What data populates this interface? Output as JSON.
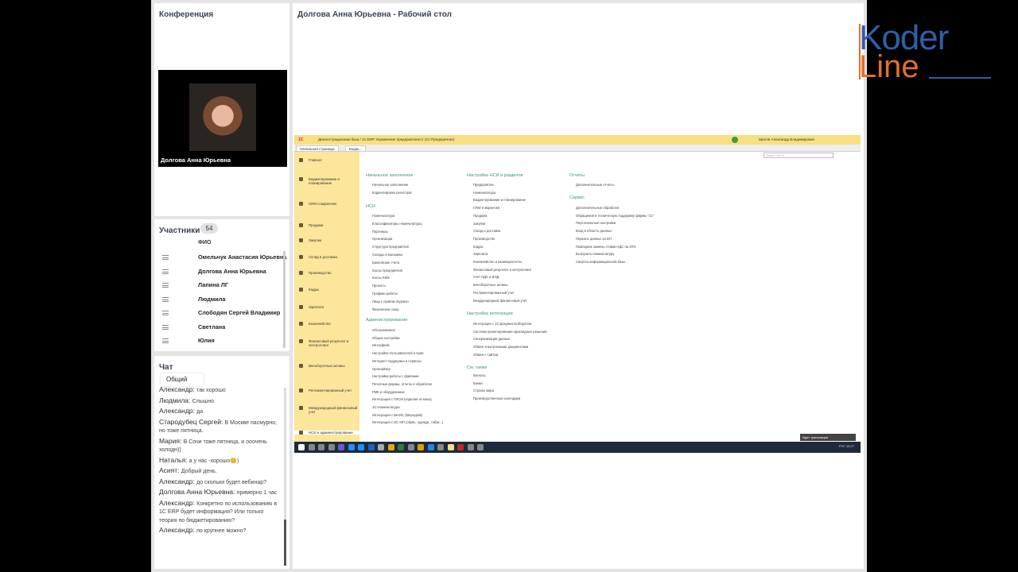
{
  "conference": {
    "title": "Конференция",
    "speaker_name": "Долгова Анна Юрьевна"
  },
  "participants": {
    "title": "Участники",
    "count": "54",
    "column_header": "ФИО",
    "list": [
      "Омельчук Анастасия Юрьевна",
      "Долгова Анна Юрьевна",
      "Лапина ЛГ",
      "Людмила",
      "Слободян Сергей Владимир",
      "Светлана",
      "Юлия"
    ]
  },
  "chat": {
    "title": "Чат",
    "tab": "Общий",
    "messages": [
      {
        "author": "Александр:",
        "text": "так хорошо"
      },
      {
        "author": "Людмила:",
        "text": "Слышно"
      },
      {
        "author": "Александр:",
        "text": "да"
      },
      {
        "author": "Стародубец Сергей:",
        "text": "В Москве пасмурно, но тоже пятница."
      },
      {
        "author": "Мария:",
        "text": "В Сочи тоже пятница, и ооочень холодн))"
      },
      {
        "author": "Наталья:",
        "text": "а у нас -хорошо😊)"
      },
      {
        "author": "Асият:",
        "text": "Добрый день."
      },
      {
        "author": "Александр:",
        "text": "до скольки будет вебинар?"
      },
      {
        "author": "Долгова Анна Юрьевна:",
        "text": "примерно 1 час"
      },
      {
        "author": "Александр:",
        "text": "Конкретно по использованию в 1С ERP будет информация? Или только теория по бюджетированию?"
      },
      {
        "author": "Александр:",
        "text": "по крупнее можно?"
      }
    ]
  },
  "desktop": {
    "title": "Долгова Анна Юрьевна - Рабочий стол"
  },
  "onec": {
    "logo": "1С",
    "window_title": "Демонстрационная база / 1С:ERP Управление предприятием 2 (1С:Предприятие)",
    "user": "Шилов Александр Владимирович",
    "tabs": [
      "Начальная страница",
      "Бюдж..."
    ],
    "search_placeholder": "Поиск Ctrl+F",
    "sidebar": [
      "Главное",
      "Бюджетирование и планирование",
      "CRM и маркетинг",
      "Продажи",
      "Закупки",
      "Склад и доставка",
      "Производство",
      "Кадры",
      "Зарплата",
      "Казначейство",
      "Финансовый результат и контроллинг",
      "Внеоборотные активы",
      "Регламентированный учет",
      "Международный финансовый учет",
      "НСИ и администрирование"
    ],
    "col1": {
      "s1": "Начальное заполнение",
      "s1_links": [
        "Начальное заполнение",
        "Корректировка регистров"
      ],
      "s2": "НСИ",
      "s2_links": [
        "Номенклатура",
        "Классификаторы номенклатуры",
        "Партнеры",
        "Организации",
        "Структура предприятия",
        "Склады и магазины",
        "Банковские счета",
        "Кассы предприятия",
        "Кассы ККМ",
        "Проекты",
        "Графики работы",
        "Лица с правом подписи",
        "Физические лица"
      ],
      "s3": "Администрирование",
      "s3_links": [
        "Обслуживание",
        "Общие настройки",
        "Интерфейс",
        "Настройки пользователей и прав",
        "Интернет-поддержка и сервисы",
        "Органайзер",
        "Настройки работы с файлами",
        "Печатные формы, отчеты и обработки",
        "РМК и оборудование",
        "Интеграция с ГИСМ (изделия из меха)",
        "1С:Номенклатура",
        "Интеграция с ВетИС (Меркурий)",
        "Интеграция с ИС МП (обувь, одежда, табак...)"
      ]
    },
    "col2": {
      "s1": "Настройка НСИ и разделов",
      "s1_links": [
        "Предприятие",
        "Номенклатура",
        "Бюджетирование и планирование",
        "CRM и маркетинг",
        "Продажи",
        "Закупки",
        "Склад и доставка",
        "Производство",
        "Кадры",
        "Зарплата",
        "Казначейство и взаиморасчеты",
        "Финансовый результат и контроллинг",
        "Учет НДС и ВЭД",
        "Внеоборотные активы",
        "Регламентированный учет",
        "Международный финансовый учет"
      ],
      "s2": "Настройка интеграции",
      "s2_links": [
        "Интеграция с 1С:Документооборотом",
        "Система проектирования прикладных решений",
        "Синхронизация данных",
        "Обмен электронными документами",
        "Обмен с сайтом"
      ],
      "s3": "См. также",
      "s3_links": [
        "Валюты",
        "Банки",
        "Страны мира",
        "Производственные календари"
      ]
    },
    "col3": {
      "s1": "Отчеты",
      "s1_links": [
        "Дополнительные отчеты"
      ],
      "s2": "Сервис",
      "s2_links": [
        "Дополнительные обработки",
        "Обращения в техническую поддержку фирмы \"1С\"",
        "Персональные настройки",
        "Вход в область данных",
        "Перенос данных из БП",
        "Помощник замены ставки НДС на 20%",
        "Выгрузить номенклатуру",
        "Свертка информационной базы"
      ]
    },
    "notification": "Идет трансляция",
    "tray": "РУС 16:27"
  },
  "brand": {
    "logo_top": "Koder",
    "logo_bottom": "Line"
  }
}
